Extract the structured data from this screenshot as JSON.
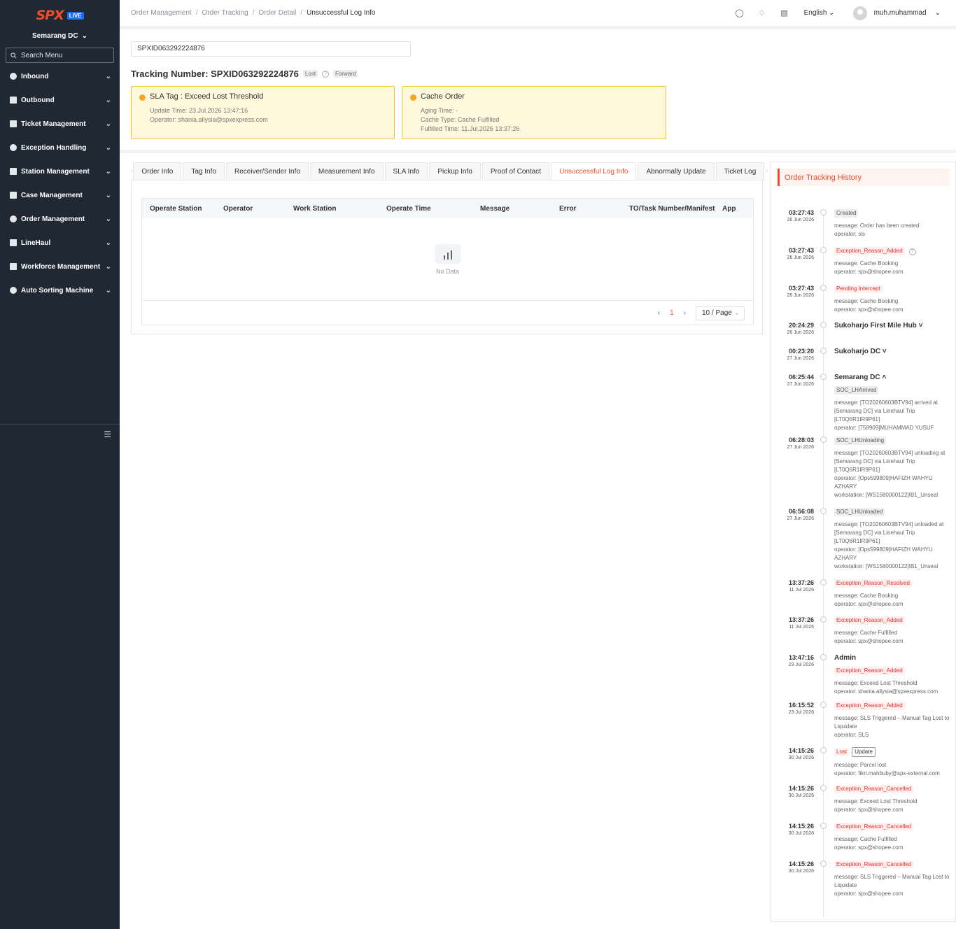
{
  "sidebar": {
    "brand": "SPX",
    "badge": "LIVE",
    "dc": "Semarang DC",
    "search_placeholder": "Search Menu",
    "items": [
      {
        "label": "Inbound",
        "icon": "inbound-icon"
      },
      {
        "label": "Outbound",
        "icon": "outbound-icon"
      },
      {
        "label": "Ticket Management",
        "icon": "ticket-icon"
      },
      {
        "label": "Exception Handling",
        "icon": "exception-icon"
      },
      {
        "label": "Station Management",
        "icon": "station-icon"
      },
      {
        "label": "Case Management",
        "icon": "case-icon"
      },
      {
        "label": "Order Management",
        "icon": "order-icon"
      },
      {
        "label": "LineHaul",
        "icon": "truck-icon"
      },
      {
        "label": "Workforce Management",
        "icon": "workforce-icon"
      },
      {
        "label": "Auto Sorting Machine",
        "icon": "sorting-icon"
      }
    ]
  },
  "breadcrumb": [
    "Order Management",
    "Order Tracking",
    "Order Detail",
    "Unsuccessful Log Info"
  ],
  "header": {
    "language": "English",
    "user": "muh.muhammad"
  },
  "tracking": {
    "input_value": "SPXID063292224876",
    "title": "Tracking Number: SPXID063292224876",
    "tag_lost": "Lost",
    "tag_forward": "Forward"
  },
  "cards": {
    "sla": {
      "title": "SLA Tag : Exceed Lost Threshold",
      "update_time": "Update Time: 23.Jul.2026 13:47:16",
      "operator": "Operator: shania.allysia@spxexpress.com"
    },
    "cache": {
      "title": "Cache Order",
      "aging": "Aging Time: -",
      "type": "Cache Type: Cache Fulfilled",
      "fulfilled": "Fulfilled Time: 11.Jul.2026 13:37:26"
    }
  },
  "tabs": [
    "Order Info",
    "Tag Info",
    "Receiver/Sender Info",
    "Measurement Info",
    "SLA Info",
    "Pickup Info",
    "Proof of Contact",
    "Unsuccessful Log Info",
    "Abnormally Update",
    "Ticket Log"
  ],
  "active_tab": "Unsuccessful Log Info",
  "table": {
    "columns": [
      "Operate Station",
      "Operator",
      "Work Station",
      "Operate Time",
      "Message",
      "Error",
      "TO/Task Number/Manifest",
      "App"
    ],
    "empty_text": "No Data",
    "page": "1",
    "page_size": "10 / Page"
  },
  "history": {
    "title": "Order Tracking History",
    "events": [
      {
        "time": "03:27:43",
        "date": "26 Jun 2026",
        "pill": "Created",
        "pill_style": "grey",
        "lines": [
          "message: Order has been created",
          "operator: sls"
        ]
      },
      {
        "time": "03:27:43",
        "date": "26 Jun 2026",
        "pill": "Exception_Reason_Added",
        "pill_style": "red",
        "lines": [
          "message: Cache Booking",
          "operator: spx@shopee.com"
        ]
      },
      {
        "time": "03:27:43",
        "date": "26 Jun 2026",
        "pill": "Pending Intercept",
        "pill_style": "red",
        "lines": [
          "message: Cache Booking",
          "operator: spx@shopee.com"
        ]
      },
      {
        "time": "20:24:29",
        "date": "26 Jun 2026",
        "location": "Sukoharjo First Mile Hub"
      },
      {
        "time": "00:23:20",
        "date": "27 Jun 2026",
        "location": "Sukoharjo DC"
      },
      {
        "time": "06:25:44",
        "date": "27 Jun 2026",
        "location": "Semarang DC",
        "pill": "SOC_LHArrived",
        "pill_style": "grey",
        "lines": [
          "message: [TO20260603BTV94] arrived at [Semarang DC] via Linehaul Trip [LT0Q6R1IR9P61]",
          "operator: [758909]MUHAMMAD YUSUF"
        ]
      },
      {
        "time": "06:28:03",
        "date": "27 Jun 2026",
        "pill": "SOC_LHUnloading",
        "pill_style": "grey",
        "lines": [
          "message: [TO20260603BTV94] unloading at [Semarang DC] via Linehaul Trip [LT0Q6R1IR9P61]",
          "operator: [Ops599809]HAFIZH WAHYU AZHARY",
          "workstation: [WS1580000122]IB1_Unseal"
        ]
      },
      {
        "time": "06:56:08",
        "date": "27 Jun 2026",
        "pill": "SOC_LHUnloaded",
        "pill_style": "grey",
        "lines": [
          "message: [TO20260603BTV94] unloaded at [Semarang DC] via Linehaul Trip [LT0Q6R1IR9P61]",
          "operator: [Ops599809]HAFIZH WAHYU AZHARY",
          "workstation: [WS1580000122]IB1_Unseal"
        ]
      },
      {
        "time": "13:37:26",
        "date": "11 Jul 2026",
        "pill": "Exception_Reason_Resolved",
        "pill_style": "red",
        "lines": [
          "message: Cache Booking",
          "operator: spx@shopee.com"
        ]
      },
      {
        "time": "13:37:26",
        "date": "11 Jul 2026",
        "pill": "Exception_Reason_Added",
        "pill_style": "red",
        "lines": [
          "message: Cache Fulfilled",
          "operator: spx@shopee.com"
        ]
      },
      {
        "time": "13:47:16",
        "date": "23 Jul 2026",
        "location": "Admin",
        "pill": "Exception_Reason_Added",
        "pill_style": "red",
        "lines": [
          "message: Exceed Lost Threshold",
          "operator: shania.allysia@spxexpress.com"
        ]
      },
      {
        "time": "16:15:52",
        "date": "23 Jul 2026",
        "pill": "Exception_Reason_Added",
        "pill_style": "red",
        "lines": [
          "message: SLS Triggered – Manual Tag Lost to Liquidate",
          "operator: SLS"
        ]
      },
      {
        "time": "14:15:26",
        "date": "30 Jul 2026",
        "pill": "Lost",
        "pill_style": "red",
        "extra_pill": "Update",
        "lines": [
          "message: Parcel lost",
          "operator: fikri.mahbuby@spx-external.com"
        ]
      },
      {
        "time": "14:15:26",
        "date": "30 Jul 2026",
        "pill": "Exception_Reason_Cancelled",
        "pill_style": "red",
        "lines": [
          "message: Exceed Lost Threshold",
          "operator: spx@shopee.com"
        ]
      },
      {
        "time": "14:15:26",
        "date": "30 Jul 2026",
        "pill": "Exception_Reason_Cancelled",
        "pill_style": "red",
        "lines": [
          "message: Cache Fulfilled",
          "operator: spx@shopee.com"
        ]
      },
      {
        "time": "14:15:26",
        "date": "30 Jul 2026",
        "pill": "Exception_Reason_Cancelled",
        "pill_style": "red",
        "lines": [
          "message: SLS Triggered – Manual Tag Lost to Liquidate",
          "operator: spx@shopee.com"
        ]
      }
    ]
  }
}
